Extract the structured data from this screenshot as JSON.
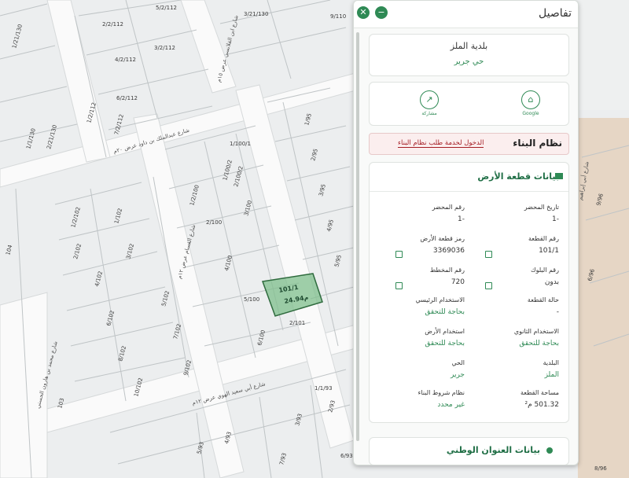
{
  "panel": {
    "title": "تفاصيل",
    "close_icon": "close-icon",
    "minimize_icon": "minimize-icon",
    "municipality": "بلدية الملز",
    "district": "حي جرير",
    "actions": [
      {
        "label": "Google",
        "icon": "map-pin-icon"
      },
      {
        "label": "مشاركة",
        "icon": "share-icon"
      }
    ],
    "building_system": {
      "title": "نظام البناء",
      "link": "الدخول لخدمة طلب نظام البناء"
    },
    "land": {
      "title": "بيانات قطعة الأرض",
      "fields": [
        {
          "label": "تاريخ المحضر",
          "value": "-1"
        },
        {
          "label": "رقم المحضر",
          "value": "-1"
        },
        {
          "label": "رقم القطعة",
          "value": "101/1"
        },
        {
          "label": "رمز قطعة الأرض",
          "value": "3369036"
        },
        {
          "label": "رقم البلوك",
          "value": "بدون"
        },
        {
          "label": "رقم المخطط",
          "value": "720"
        },
        {
          "label": "حالة القطعة",
          "value": "-"
        },
        {
          "label": "الاستخدام الرئيسي",
          "value": "بحاجة للتحقق"
        },
        {
          "label": "الاستخدام الثانوي",
          "value": "بحاجة للتحقق"
        },
        {
          "label": "استخدام الأرض",
          "value": "بحاجة للتحقق"
        },
        {
          "label": "البلدية",
          "value": "الملز"
        },
        {
          "label": "الحي",
          "value": "جرير"
        },
        {
          "label": "مساحة القطعة",
          "value": "501.32 م²"
        },
        {
          "label": "نظام شروط البناء",
          "value": "غير محدد"
        }
      ]
    },
    "address_title": "بيانات العنوان الوطني"
  },
  "map": {
    "selected_parcel": {
      "label1": "101/1",
      "label2": "24.94م"
    },
    "parcel_labels": [
      "1/21/130",
      "2/2/112",
      "1/2/112",
      "3/2/112",
      "4/2/112",
      "5/2/112",
      "6/2/112",
      "7/2/112",
      "1/1/130",
      "2/21/130",
      "3/21/130",
      "1/100/1",
      "1/100/2",
      "2/100/2",
      "1/2/100",
      "2/100",
      "3/100",
      "4/100",
      "5/100",
      "6/100",
      "2/101",
      "1/95",
      "2/95",
      "3/95",
      "4/95",
      "5/95",
      "1/102",
      "2/102",
      "3/102",
      "4/102",
      "5/102",
      "6/102",
      "7/102",
      "8/102",
      "9/102",
      "10/102",
      "1/2/102",
      "104",
      "103",
      "1/1/93",
      "2/93",
      "3/93",
      "4/93",
      "5/93",
      "6/93",
      "7/93",
      "8/96",
      "9/96",
      "6/96",
      "9/110"
    ],
    "streets": [
      "شارع عبدالملك بن داود عرض ٢٠م",
      "شارع ابن القلانسي عرض ١٥م",
      "شارع أبي سعيد الهوي عرض ١٢م",
      "شارع القسام عرض ١٢م",
      "شارع أبي إبراهيم",
      "شارع محمد بن هارون الحسني"
    ]
  }
}
